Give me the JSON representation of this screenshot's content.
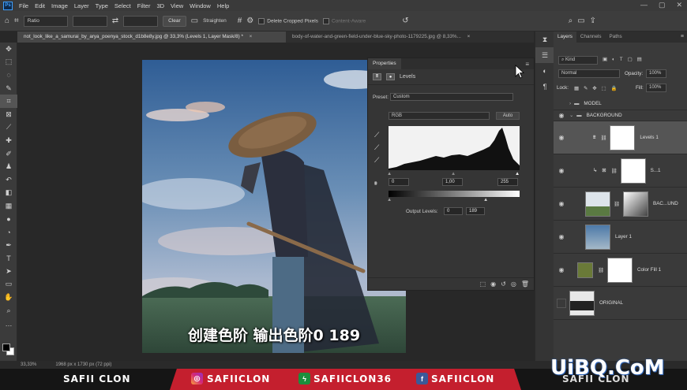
{
  "menubar": {
    "app_logo": "Ps",
    "items": [
      "File",
      "Edit",
      "Image",
      "Layer",
      "Type",
      "Select",
      "Filter",
      "3D",
      "View",
      "Window",
      "Help"
    ]
  },
  "options_bar": {
    "ratio_select": "Ratio",
    "clear_label": "Clear",
    "straighten_label": "Straighten",
    "delete_cropped_label": "Delete Cropped Pixels",
    "content_aware_label": "Content-Aware"
  },
  "tabs": [
    {
      "label": "not_look_like_a_samurai_by_arya_poenya_stock_d1b8e8y.jpg @ 33,3% (Levels 1, Layer Mask/8) *",
      "close": "×"
    },
    {
      "label": "body-of-water-and-green-field-under-blue-sky-photo-1179225.jpg @ 8,33%...",
      "close": "×"
    }
  ],
  "properties": {
    "tab_label": "Properties",
    "adjustment_name": "Levels",
    "preset_label": "Preset:",
    "preset_value": "Custom",
    "channel_value": "RGB",
    "auto_label": "Auto",
    "input_black": "0",
    "input_gamma": "1,00",
    "input_white": "255",
    "output_label": "Output Levels:",
    "output_black": "0",
    "output_white": "189"
  },
  "layers_panel": {
    "tabs": [
      "Layers",
      "Channels",
      "Paths"
    ],
    "kind_label": "Kind",
    "blend_mode": "Normal",
    "opacity_label": "Opacity:",
    "opacity_value": "100%",
    "lock_label": "Lock:",
    "fill_label": "Fill:",
    "fill_value": "100%",
    "groups": [
      {
        "name": "MODEL"
      },
      {
        "name": "BACKGROUND"
      }
    ],
    "layers": [
      {
        "name": "Levels 1",
        "selected": true
      },
      {
        "name": "S...1"
      },
      {
        "name": "BAC...UND"
      },
      {
        "name": "Layer 1"
      },
      {
        "name": "Color Fill 1"
      },
      {
        "name": "ORIGINAL"
      }
    ],
    "colors": {
      "color_fill": "#6a7a38"
    }
  },
  "status_bar": {
    "zoom": "33,33%",
    "doc_info": "1968 px x 1730 px (72 ppi)"
  },
  "subtitle": "创建色阶 输出色阶0 189",
  "banner": {
    "left_name": "SAFII CLON",
    "instagram": "SAFIICLON",
    "other": "SAFIICLON36",
    "facebook": "SAFIICLON",
    "right_name": "SAFII CLON",
    "watermark": "UiBQ.CoM",
    "colors": {
      "banner_red": "#c41f2e"
    }
  }
}
